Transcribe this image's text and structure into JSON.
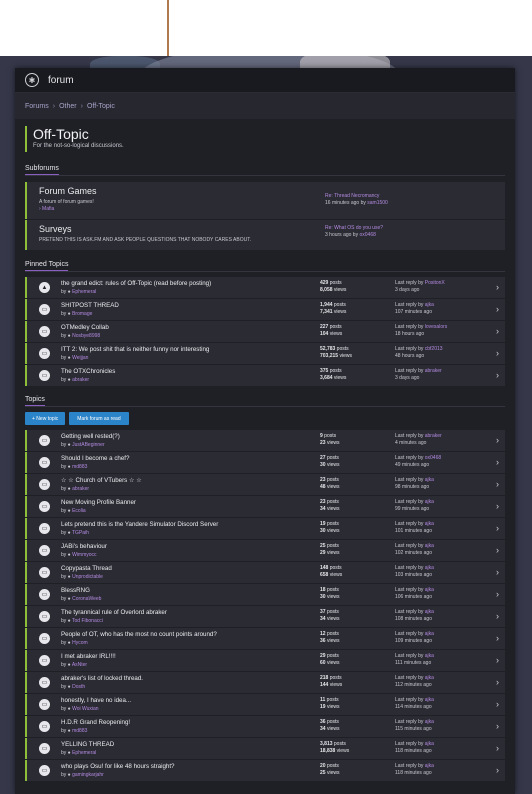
{
  "header": {
    "title": "forum",
    "logo_glyph": "logo-icon"
  },
  "breadcrumb": [
    "Forums",
    "Other",
    "Off-Topic"
  ],
  "page": {
    "title": "Off-Topic",
    "subtitle": "For the not-so-logical discussions."
  },
  "subforums_heading": "Subforums",
  "subforums": [
    {
      "name": "Forum Games",
      "desc": "A forum of forum games!",
      "child": "› Mafia",
      "last_title": "Re: Thread Necromancy",
      "last_meta": "16 minutes ago by",
      "last_user": "sam1500"
    },
    {
      "name": "Surveys",
      "desc": "PRETEND THIS IS ASK.FM AND ASK PEOPLE QUESTIONS THAT NOBODY CARES ABOUT.",
      "child": "",
      "last_title": "Re: What OS do you use?",
      "last_meta": "3 hours ago by",
      "last_user": "ox0468"
    }
  ],
  "pinned_heading": "Pinned Topics",
  "pinned": [
    {
      "icon": "warning",
      "title": "the grand edict: rules of Off-Topic (read before posting)",
      "by": "Ephemeral",
      "posts": "429",
      "views": "8,058",
      "last_by": "PositonX",
      "last_time": "3 days ago"
    },
    {
      "icon": "chat",
      "title": "SHITPOST THREAD",
      "by": "Bromage",
      "posts": "1,944",
      "views": "7,341",
      "last_by": "ajka",
      "last_time": "107 minutes ago"
    },
    {
      "icon": "chat",
      "title": "OTMedley Collab",
      "by": "Nosbye8998",
      "posts": "227",
      "views": "104",
      "last_by": "lovesalors",
      "last_time": "18 hours ago"
    },
    {
      "icon": "chat",
      "title": "ITT 2: We post shit that is neither funny nor interesting",
      "by": "Weijjan",
      "posts": "52,783",
      "views": "703,215",
      "last_by": "cbf2013",
      "last_time": "48 hours ago"
    },
    {
      "icon": "chat",
      "title": "The OTXChronicles",
      "by": "abraker",
      "posts": "375",
      "views": "3,684",
      "last_by": "abraker",
      "last_time": "3 days ago"
    }
  ],
  "topics_heading": "Topics",
  "buttons": {
    "new_topic": "+ New topic",
    "mark_read": "Mark forum as read"
  },
  "labels": {
    "posts": "posts",
    "views": "views",
    "last_reply": "Last reply by",
    "by": "by"
  },
  "topics": [
    {
      "title": "Getting well rested(?)",
      "by": "JustABeginner",
      "posts": "9",
      "views": "23",
      "last_by": "abraker",
      "last_time": "4 minutes ago"
    },
    {
      "title": "Should I become a chef?",
      "by": "md883",
      "posts": "27",
      "views": "30",
      "last_by": "ox0468",
      "last_time": "49 minutes ago"
    },
    {
      "title": "☆ ☆ Church of VTubers ☆ ☆",
      "by": "abraker",
      "posts": "23",
      "views": "48",
      "last_by": "ajka",
      "last_time": "98 minutes ago"
    },
    {
      "title": "New Moving Profile Banner",
      "by": "Ecolia",
      "posts": "23",
      "views": "34",
      "last_by": "ajka",
      "last_time": "99 minutes ago"
    },
    {
      "title": "Lets pretend this is the Yandere Simulator Discord Server",
      "by": "TGPaih",
      "posts": "19",
      "views": "30",
      "last_by": "ajka",
      "last_time": "101 minutes ago"
    },
    {
      "title": "JABi's behaviour",
      "by": "Wimmyocc",
      "posts": "25",
      "views": "29",
      "last_by": "ajka",
      "last_time": "102 minutes ago"
    },
    {
      "title": "Copypasta Thread",
      "by": "Unprodictable",
      "posts": "148",
      "views": "658",
      "last_by": "ajka",
      "last_time": "103 minutes ago"
    },
    {
      "title": "BlessRNG",
      "by": "CoronaWeeb",
      "posts": "18",
      "views": "30",
      "last_by": "ajka",
      "last_time": "106 minutes ago"
    },
    {
      "title": "The tyrannical rule of Overlord abraker",
      "by": "Tod Fibonacci",
      "posts": "37",
      "views": "34",
      "last_by": "ajka",
      "last_time": "108 minutes ago"
    },
    {
      "title": "People of OT, who has the most no count points around?",
      "by": "Hycom",
      "posts": "12",
      "views": "36",
      "last_by": "ajka",
      "last_time": "109 minutes ago"
    },
    {
      "title": "I met abraker IRL!!!!",
      "by": "AsNter",
      "posts": "29",
      "views": "60",
      "last_by": "ajka",
      "last_time": "111 minutes ago"
    },
    {
      "title": "abraker's list of locked thread.",
      "by": "Dosth",
      "posts": "218",
      "views": "144",
      "last_by": "ajka",
      "last_time": "112 minutes ago"
    },
    {
      "title": "honestly, I have no idea...",
      "by": "Woi Wuxian",
      "posts": "11",
      "views": "19",
      "last_by": "ajka",
      "last_time": "114 minutes ago"
    },
    {
      "title": "H.D.R Grand Reopening!",
      "by": "md883",
      "posts": "36",
      "views": "34",
      "last_by": "ajka",
      "last_time": "115 minutes ago"
    },
    {
      "title": "YELLING THREAD",
      "by": "Ephemeral",
      "posts": "3,813",
      "views": "18,838",
      "last_by": "ajka",
      "last_time": "118 minutes ago"
    },
    {
      "title": "who plays Osu! for like 48 hours straight?",
      "by": "gamingkarjahr",
      "posts": "20",
      "views": "25",
      "last_by": "ajka",
      "last_time": "118 minutes ago"
    }
  ]
}
